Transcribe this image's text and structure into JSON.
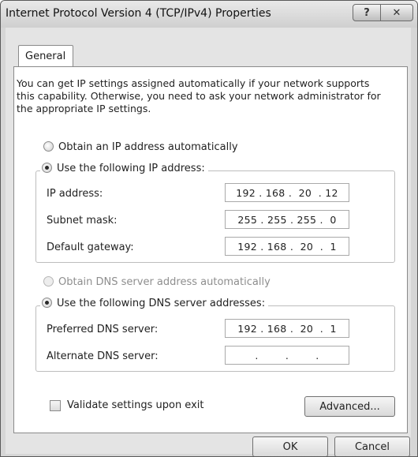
{
  "window": {
    "title": "Internet Protocol Version 4 (TCP/IPv4) Properties",
    "help_button": "?",
    "close_button": "✕"
  },
  "tabs": [
    {
      "label": "General",
      "selected": true
    }
  ],
  "intro_text": "You can get IP settings assigned automatically if your network supports this capability. Otherwise, you need to ask your network administrator for the appropriate IP settings.",
  "ip": {
    "auto_option": {
      "label": "Obtain an IP address automatically",
      "checked": false
    },
    "manual_option": {
      "label": "Use the following IP address:",
      "checked": true
    },
    "fields": [
      {
        "label": "IP address:",
        "value": "192 . 168 .  20  . 12"
      },
      {
        "label": "Subnet mask:",
        "value": "255 . 255 . 255 .  0"
      },
      {
        "label": "Default gateway:",
        "value": "192 . 168 .  20  .  1"
      }
    ]
  },
  "dns": {
    "auto_option": {
      "label": "Obtain DNS server address automatically",
      "checked": false,
      "disabled": true
    },
    "manual_option": {
      "label": "Use the following DNS server addresses:",
      "checked": true
    },
    "fields": [
      {
        "label": "Preferred DNS server:",
        "value": "192 . 168 .  20  .  1"
      },
      {
        "label": "Alternate DNS server:",
        "value": ".        .        ."
      }
    ]
  },
  "validate": {
    "label": "Validate settings upon exit",
    "checked": false
  },
  "buttons": {
    "advanced": "Advanced...",
    "ok": "OK",
    "cancel": "Cancel"
  }
}
